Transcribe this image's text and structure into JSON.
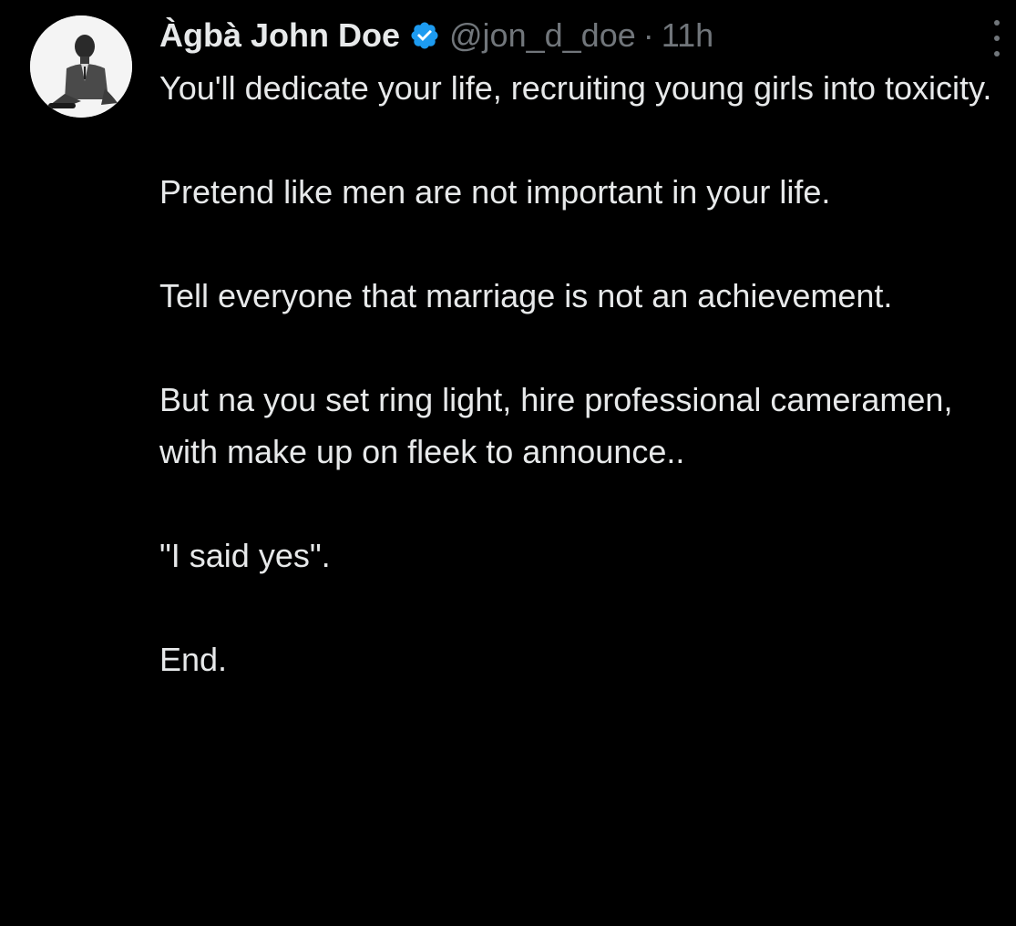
{
  "tweet": {
    "author": {
      "name": "Àgbà John Doe",
      "handle": "@jon_d_doe",
      "separator": "·",
      "time": "11h",
      "verified": true,
      "verified_color": "#1d9bf0"
    },
    "paragraphs": [
      "You'll dedicate your life, recruiting young girls into toxicity.",
      "Pretend like men are not important in your life.",
      "Tell everyone that marriage is not an achievement.",
      "But na you set ring light, hire professional cameramen, with make up on fleek to announce..",
      "\"I said yes\".",
      "End."
    ]
  },
  "colors": {
    "background": "#000000",
    "primary_text": "#e7e9ea",
    "secondary_text": "#71767b",
    "accent": "#1d9bf0"
  },
  "icons": {
    "verified": "verified-badge-icon",
    "more": "more-vertical-icon"
  }
}
